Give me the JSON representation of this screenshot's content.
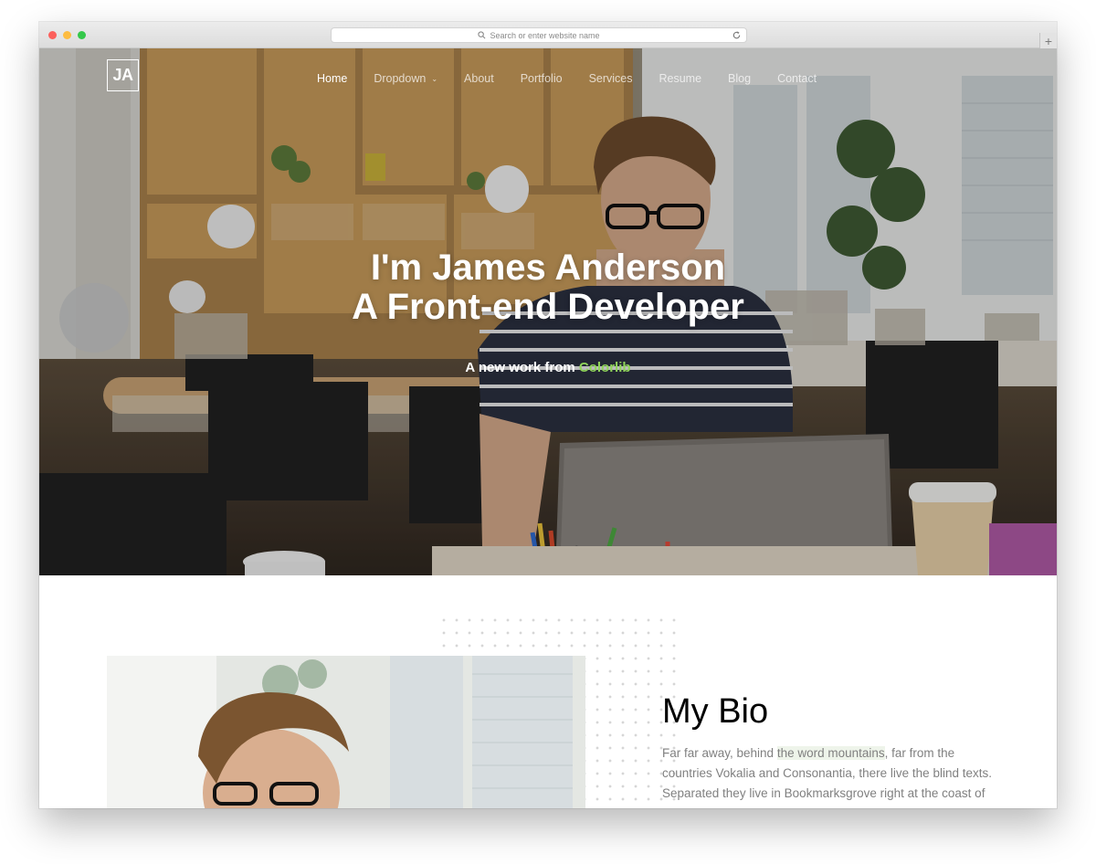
{
  "browser": {
    "address_placeholder": "Search or enter website name",
    "newtab_label": "+"
  },
  "site": {
    "logo": "JA",
    "nav": [
      {
        "label": "Home",
        "active": true
      },
      {
        "label": "Dropdown",
        "has_caret": true
      },
      {
        "label": "About"
      },
      {
        "label": "Portfolio"
      },
      {
        "label": "Services"
      },
      {
        "label": "Resume"
      },
      {
        "label": "Blog"
      },
      {
        "label": "Contact"
      }
    ],
    "caret_glyph": "⌄"
  },
  "hero": {
    "title_line1": "I'm James Anderson",
    "title_line2": "A Front-end Developer",
    "subtitle_prefix": "A new work from",
    "subtitle_brand": "Colorlib",
    "brand_color": "#8fd35a"
  },
  "about": {
    "title": "My Bio",
    "text_part1": "Far far away, behind ",
    "text_highlight": "the word mountains",
    "text_part2": ", far from the countries Vokalia and Consonantia, there live the blind texts. Separated they live in Bookmarksgrove right at the coast of the Semantics, a large language ocean."
  }
}
